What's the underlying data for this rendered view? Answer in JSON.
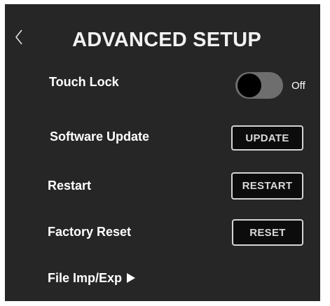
{
  "header": {
    "title": "ADVANCED SETUP",
    "back_icon": "chevron-left-icon"
  },
  "touch_lock": {
    "label": "Touch Lock",
    "state_label": "Off",
    "enabled": false
  },
  "software_update": {
    "label": "Software Update",
    "button_label": "UPDATE"
  },
  "restart": {
    "label": "Restart",
    "button_label": "RESTART"
  },
  "factory_reset": {
    "label": "Factory Reset",
    "button_label": "RESET"
  },
  "file_import_export": {
    "label": "File Imp/Exp",
    "arrow_icon": "play-arrow-icon"
  },
  "colors": {
    "background": "#262626",
    "text": "#ffffff",
    "button_fill": "#0c0c0c",
    "button_border": "#d4d4d4",
    "toggle_track": "#6e6e6e",
    "toggle_knob": "#000000"
  }
}
